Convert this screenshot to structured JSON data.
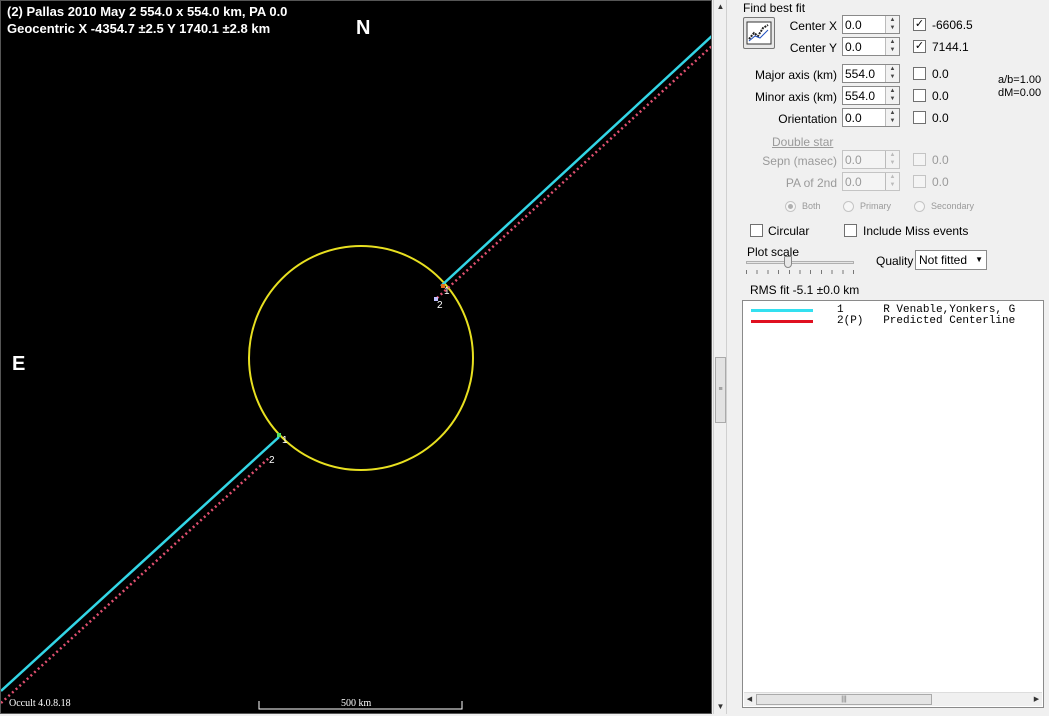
{
  "plot": {
    "title_line1": "(2) Pallas  2010 May 2  554.0 x 554.0 km, PA 0.0",
    "title_line2": "Geocentric  X  -4354.7 ±2.5  Y 1740.1 ±2.8 km",
    "north_label": "N",
    "east_label": "E",
    "version": "Occult 4.0.8.18",
    "scale_label": "500 km",
    "chords": [
      {
        "name": "1",
        "color": "#33d6e6"
      },
      {
        "name": "2",
        "color": "#e05070"
      }
    ],
    "ellipse_color": "#e8e020"
  },
  "panel": {
    "group_title": "Find best fit",
    "fit_button_icon": "plot-fit-icon",
    "center_x": {
      "label": "Center X",
      "value": "0.0",
      "checked": true,
      "result": "-6606.5"
    },
    "center_y": {
      "label": "Center Y",
      "value": "0.0",
      "checked": true,
      "result": "7144.1"
    },
    "major_axis": {
      "label": "Major axis (km)",
      "value": "554.0",
      "checked": false,
      "result": "0.0"
    },
    "minor_axis": {
      "label": "Minor axis (km)",
      "value": "554.0",
      "checked": false,
      "result": "0.0"
    },
    "orientation": {
      "label": "Orientation",
      "value": "0.0",
      "checked": false,
      "result": "0.0"
    },
    "ratio": "a/b=1.00",
    "dm": "dM=0.00",
    "double_star": "Double star",
    "sepn": {
      "label": "Sepn (masec)",
      "value": "0.0",
      "result": "0.0"
    },
    "pa2": {
      "label": "PA of 2nd",
      "value": "0.0",
      "result": "0.0"
    },
    "radio_both": "Both",
    "radio_primary": "Primary",
    "radio_secondary": "Secondary",
    "circular": {
      "label": "Circular",
      "checked": false
    },
    "include_miss": {
      "label": "Include Miss events",
      "checked": false
    },
    "plot_scale_label": "Plot scale",
    "quality_label": "Quality",
    "quality_value": "Not fitted",
    "rms_text": "RMS fit -5.1 ±0.0 km"
  },
  "legend": {
    "rows": [
      {
        "color": "#33e0f0",
        "text": "1      R Venable,Yonkers, G"
      },
      {
        "color": "#e01020",
        "text": "2(P)   Predicted Centerline"
      }
    ]
  }
}
